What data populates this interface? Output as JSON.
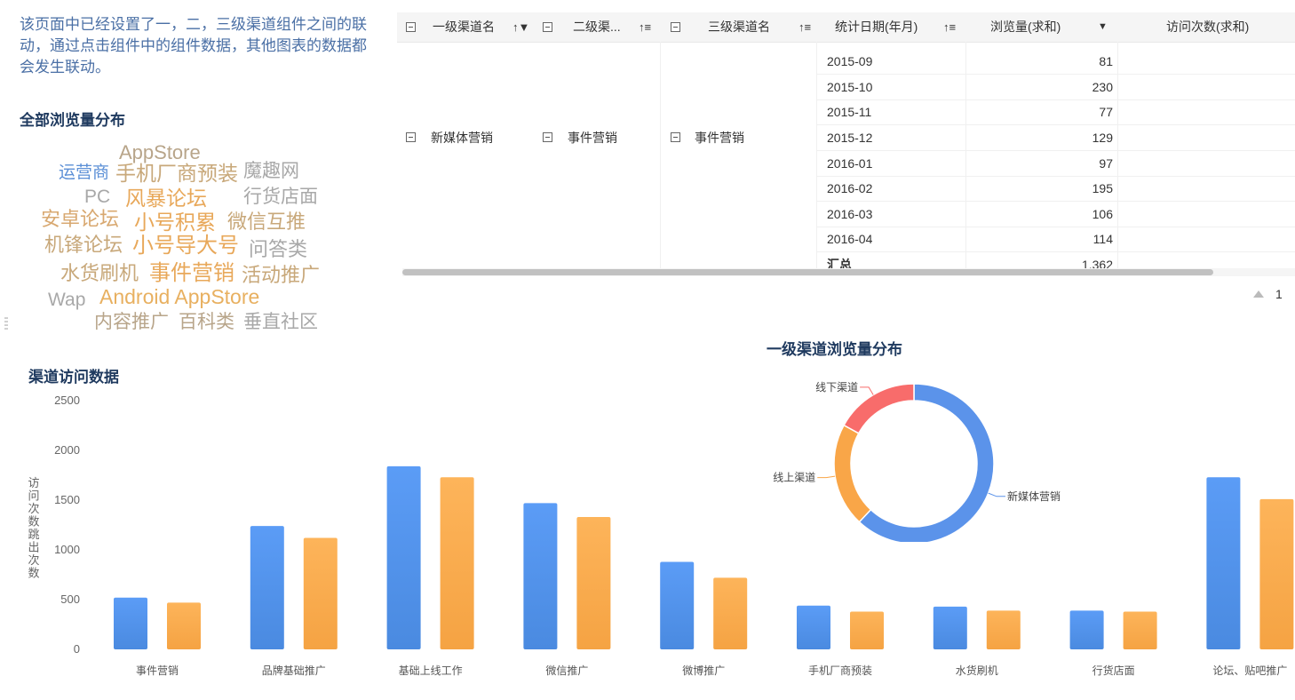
{
  "intro_text": "该页面中已经设置了一，二，三级渠道组件之间的联动，通过点击组件中的组件数据，其他图表的数据都会发生联动。",
  "word_cloud": {
    "title": "全部浏览量分布",
    "words": [
      {
        "text": "AppStore",
        "color": "#b8a58a"
      },
      {
        "text": "运营商",
        "color": "#5b8fd6"
      },
      {
        "text": "手机厂商预装",
        "color": "#c8a87a"
      },
      {
        "text": "魔趣网",
        "color": "#a8a8a8"
      },
      {
        "text": "PC",
        "color": "#a8a8a8"
      },
      {
        "text": "风暴论坛",
        "color": "#e8a85a"
      },
      {
        "text": "行货店面",
        "color": "#a8a8a8"
      },
      {
        "text": "安卓论坛",
        "color": "#d8a870"
      },
      {
        "text": "小号积累",
        "color": "#e8a85a"
      },
      {
        "text": "微信互推",
        "color": "#c8a87a"
      },
      {
        "text": "机锋论坛",
        "color": "#c8a87a"
      },
      {
        "text": "小号导大号",
        "color": "#e8a85a"
      },
      {
        "text": "问答类",
        "color": "#a8a8a8"
      },
      {
        "text": "水货刷机",
        "color": "#c8a87a"
      },
      {
        "text": "事件营销",
        "color": "#e8a85a"
      },
      {
        "text": "活动推广",
        "color": "#c8a87a"
      },
      {
        "text": "Wap",
        "color": "#a8a8a8"
      },
      {
        "text": "Android AppStore",
        "color": "#e8b060"
      },
      {
        "text": "内容推广",
        "color": "#b8a58a"
      },
      {
        "text": "百科类",
        "color": "#b8a58a"
      },
      {
        "text": "垂直社区",
        "color": "#a8a8a8"
      }
    ]
  },
  "table": {
    "headers": [
      "一级渠道名",
      "二级渠...",
      "三级渠道名",
      "统计日期(年月)",
      "浏览量(求和)",
      "访问次数(求和)"
    ],
    "sort_icons": [
      "↑▼",
      "↑≡",
      "↑≡",
      "↑≡",
      "▼",
      ""
    ],
    "row_group": {
      "level1": "新媒体营销",
      "level2": "事件营销",
      "level3": "事件营销"
    },
    "rows": [
      {
        "date": "2015-09",
        "views": "81"
      },
      {
        "date": "2015-10",
        "views": "230"
      },
      {
        "date": "2015-11",
        "views": "77"
      },
      {
        "date": "2015-12",
        "views": "129"
      },
      {
        "date": "2016-01",
        "views": "97"
      },
      {
        "date": "2016-02",
        "views": "195"
      },
      {
        "date": "2016-03",
        "views": "106"
      },
      {
        "date": "2016-04",
        "views": "114"
      }
    ],
    "summary": {
      "label": "汇总",
      "views": "1,362"
    },
    "pager": {
      "page": "1"
    }
  },
  "bar_title": "渠道访问数据",
  "donut_title": "一级渠道浏览量分布",
  "chart_data": [
    {
      "type": "bar",
      "title": "渠道访问数据",
      "ylabel": "访问次数跳出次数",
      "ylim": [
        0,
        2500
      ],
      "yticks": [
        "0",
        "500",
        "1000",
        "1500",
        "2000",
        "2500"
      ],
      "categories": [
        "事件营销",
        "品牌基础推广",
        "基础上线工作",
        "微信推广",
        "微博推广",
        "手机厂商预装",
        "水货刷机",
        "行货店面",
        "论坛、贴吧推广"
      ],
      "series": [
        {
          "values": [
            520,
            1240,
            1840,
            1470,
            880,
            440,
            430,
            390,
            1730
          ],
          "color": "#5b9cf6"
        },
        {
          "values": [
            470,
            1120,
            1730,
            1330,
            720,
            380,
            390,
            380,
            1510
          ],
          "color": "#fbb04e"
        }
      ]
    },
    {
      "type": "pie",
      "title": "一级渠道浏览量分布",
      "slices": [
        {
          "label": "新媒体营销",
          "value": 62,
          "color": "#5b93ea"
        },
        {
          "label": "线上渠道",
          "value": 21,
          "color": "#f9a648"
        },
        {
          "label": "线下渠道",
          "value": 17,
          "color": "#f86c6b"
        }
      ]
    }
  ]
}
